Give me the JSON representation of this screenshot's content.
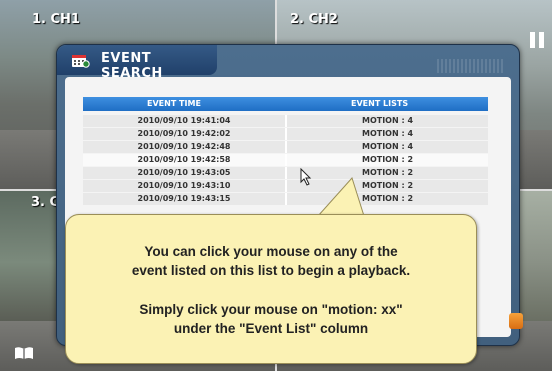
{
  "cameras": [
    {
      "label": "1. CH1"
    },
    {
      "label": "2. CH2"
    },
    {
      "label": "3. C"
    },
    {
      "label": ""
    }
  ],
  "dialog": {
    "title": "EVENT SEARCH",
    "columns": [
      "EVENT TIME",
      "EVENT LISTS"
    ],
    "rows": [
      {
        "time": "2010/09/10 19:41:04",
        "event": "MOTION : 4"
      },
      {
        "time": "2010/09/10 19:42:02",
        "event": "MOTION : 4"
      },
      {
        "time": "2010/09/10 19:42:48",
        "event": "MOTION : 4"
      },
      {
        "time": "2010/09/10 19:42:58",
        "event": "MOTION : 2"
      },
      {
        "time": "2010/09/10 19:43:05",
        "event": "MOTION : 2"
      },
      {
        "time": "2010/09/10 19:43:10",
        "event": "MOTION : 2"
      },
      {
        "time": "2010/09/10 19:43:15",
        "event": "MOTION : 2"
      }
    ]
  },
  "callout": {
    "line1": "You can click your mouse on any of the",
    "line2": "event listed on this list to begin a playback.",
    "line3": "Simply click your mouse on \"motion: xx\"",
    "line4": "under the \"Event List\" column"
  },
  "icons": {
    "pause": "pause-icon",
    "book": "book-icon",
    "calendar": "calendar-search-icon",
    "cursor": "mouse-cursor-icon"
  }
}
